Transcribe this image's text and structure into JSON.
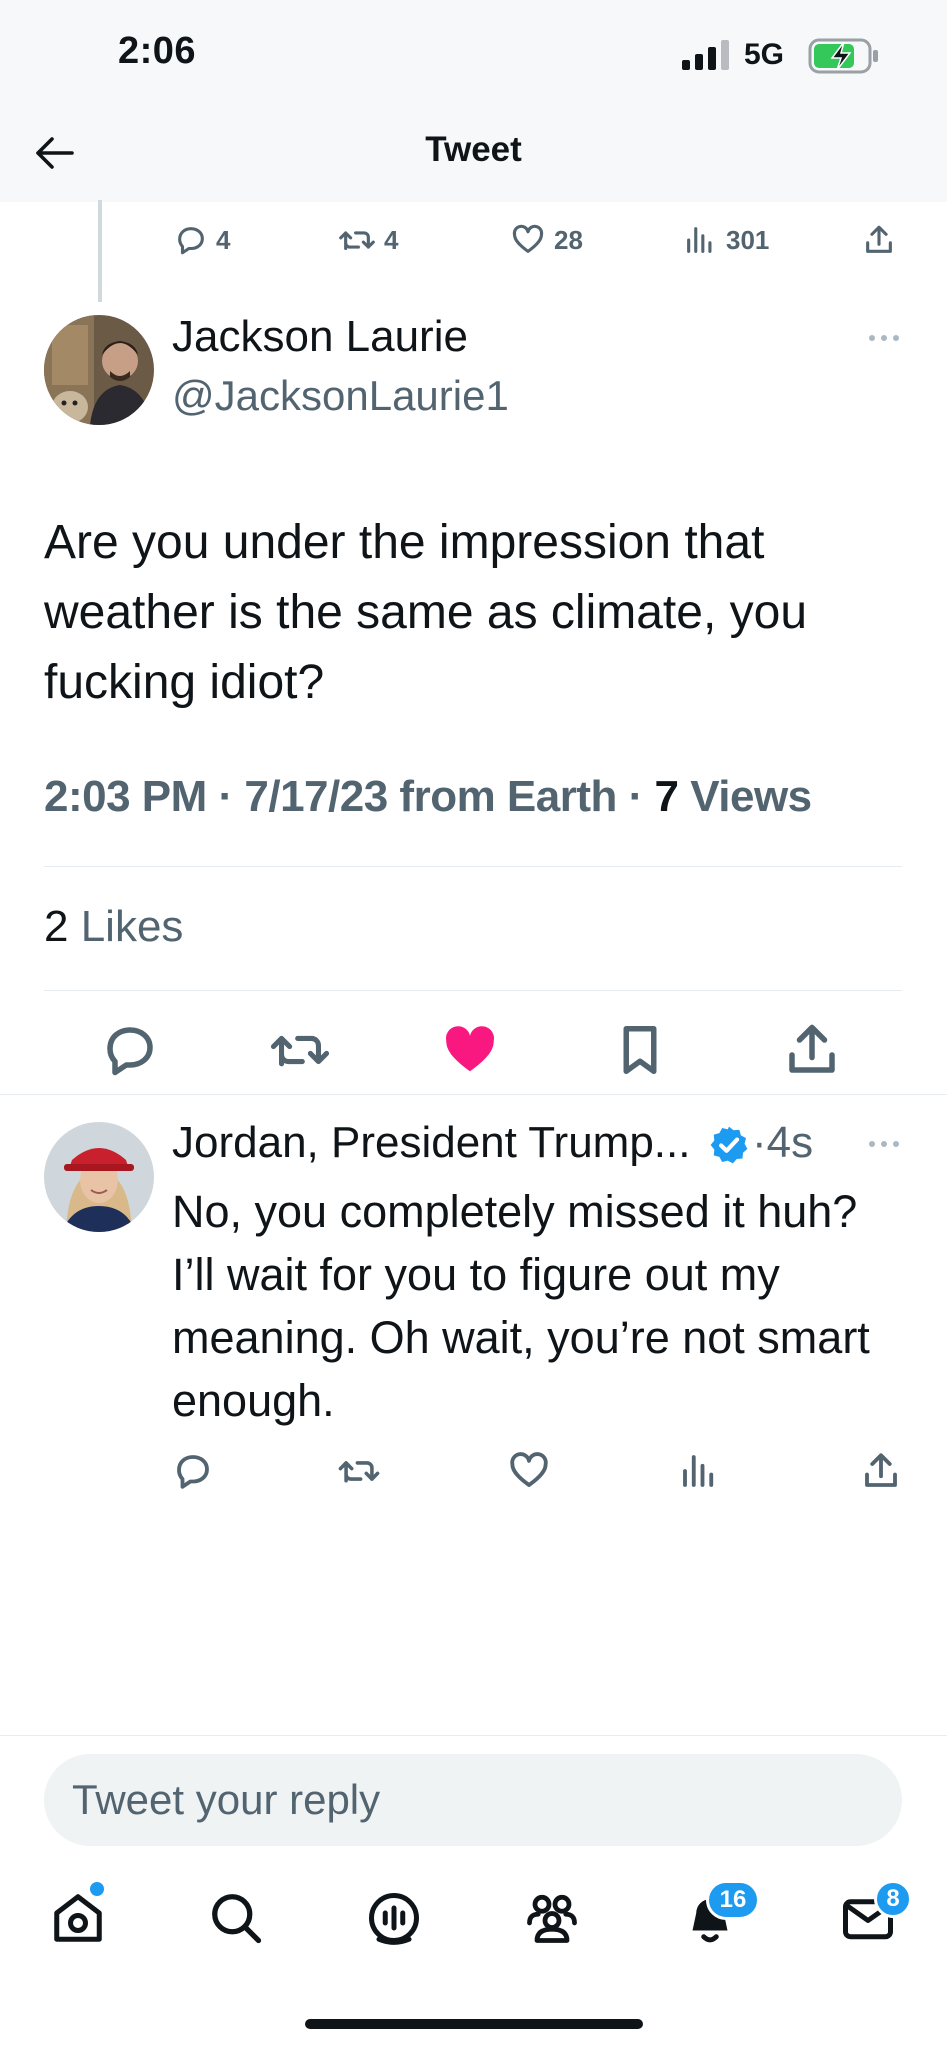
{
  "status_bar": {
    "time": "2:06",
    "network": "5G"
  },
  "header": {
    "title": "Tweet"
  },
  "parent_stats": {
    "replies": "4",
    "retweets": "4",
    "likes": "28",
    "views": "301"
  },
  "tweet": {
    "author_name": "Jackson Laurie",
    "author_handle": "@JacksonLaurie1",
    "text": "Are you under the impression that weather is the same as climate, you fucking idiot?",
    "meta_time": "2:03 PM · 7/17/23 from Earth · ",
    "meta_views_count": "7",
    "meta_views_label": " Views",
    "likes_count": "2",
    "likes_label": " Likes",
    "liked": true
  },
  "reply": {
    "author_name": "Jordan, President Trump...",
    "verified": true,
    "time": "·4s",
    "text": "No, you completely missed it huh? I’ll wait for you to figure out my meaning. Oh wait, you’re not smart enough."
  },
  "composer": {
    "placeholder": "Tweet your reply"
  },
  "tab_bar": {
    "items": [
      "home-icon",
      "search-icon",
      "spaces-icon",
      "communities-icon",
      "notifications-icon",
      "messages-icon"
    ],
    "notifications_badge": "16",
    "messages_badge": "8"
  },
  "colors": {
    "like": "#f91880",
    "verified": "#1d9bf0",
    "secondary_text": "#536471"
  }
}
